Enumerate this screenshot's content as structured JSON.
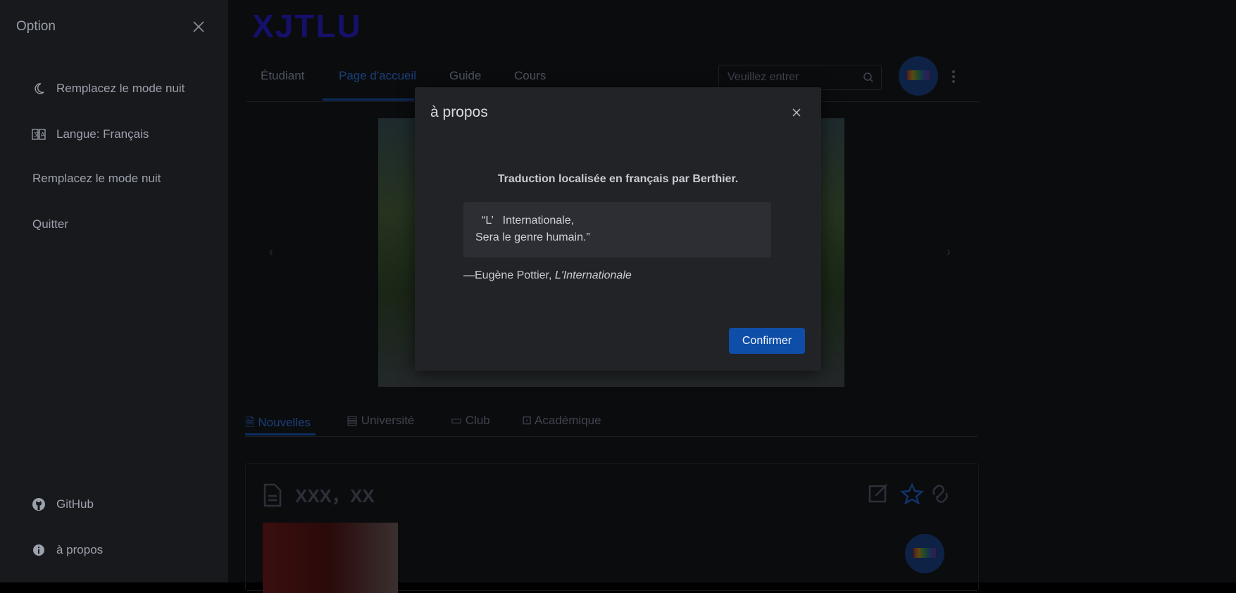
{
  "app": {
    "logo": "XJTLU",
    "nav_tabs": [
      {
        "label": "Étudiant"
      },
      {
        "label": "Page d'accueil",
        "active": true
      },
      {
        "label": "Guide"
      },
      {
        "label": "Cours"
      }
    ],
    "search": {
      "placeholder": "Veuillez entrer"
    },
    "sub_tabs": [
      {
        "label": "Nouvelles",
        "icon": "document-icon",
        "active": true
      },
      {
        "label": "Université",
        "icon": "building-icon"
      },
      {
        "label": "Club",
        "icon": "cup-icon"
      },
      {
        "label": "Académique",
        "icon": "cart-icon"
      }
    ],
    "card": {
      "title": "XXX，XX"
    }
  },
  "drawer": {
    "title": "Option",
    "items": [
      {
        "label": "Remplacez le mode nuit",
        "icon": "moon-icon"
      },
      {
        "label": "Langue: Français",
        "icon": "translate-icon"
      },
      {
        "label": "Remplacez le mode nuit",
        "icon": ""
      },
      {
        "label": "Quitter",
        "icon": ""
      }
    ],
    "bottom_items": [
      {
        "label": "GitHub",
        "icon": "github-icon"
      },
      {
        "label": "à propos",
        "icon": "info-icon"
      }
    ]
  },
  "modal": {
    "title": "à propos",
    "heading": "Traduction localisée en français par Berthier.",
    "quote_line1": "“L’   Internationale,",
    "quote_line2": "Sera le genre humain.”",
    "attribution_prefix": "—Eugène Pottier, ",
    "attribution_work": "L'Internationale",
    "confirm_label": "Confirmer"
  },
  "colors": {
    "accent": "#0f4ea8",
    "modal_bg": "#222327",
    "drawer_bg": "#18191d"
  }
}
